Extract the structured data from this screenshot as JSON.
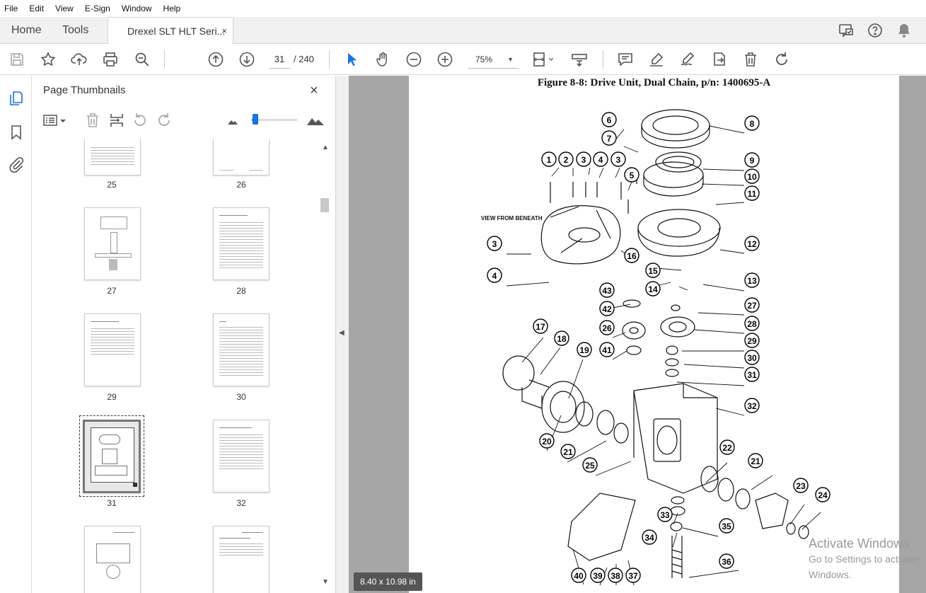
{
  "menu": [
    "File",
    "Edit",
    "View",
    "E-Sign",
    "Window",
    "Help"
  ],
  "tabs": {
    "home": "Home",
    "tools": "Tools",
    "document": "Drexel SLT HLT Seri...",
    "close": "×"
  },
  "nav": {
    "current_page": "31",
    "total_pages": "/ 240",
    "zoom": "75%"
  },
  "icons": [
    "save-icon",
    "star-icon",
    "upload-icon",
    "print-icon",
    "zoom-search-icon",
    "page-up-icon",
    "page-down-icon",
    "select-arrow-icon",
    "hand-icon",
    "zoom-out-icon",
    "zoom-in-icon",
    "fit-page-icon",
    "scroll-mode-icon",
    "comment-icon",
    "highlight-icon",
    "sign-icon",
    "share-icon",
    "delete-icon",
    "rotate-icon",
    "comments-pane-icon",
    "help-icon",
    "bell-icon",
    "thumbnails-icon",
    "bookmarks-icon",
    "attachments-icon"
  ],
  "thumbnails_panel": {
    "title": "Page Thumbnails",
    "close": "×",
    "pages": [
      {
        "label": "25",
        "selected": false
      },
      {
        "label": "26",
        "selected": false
      },
      {
        "label": "27",
        "selected": false
      },
      {
        "label": "28",
        "selected": false
      },
      {
        "label": "29",
        "selected": false
      },
      {
        "label": "30",
        "selected": false
      },
      {
        "label": "31",
        "selected": true
      },
      {
        "label": "32",
        "selected": false
      },
      {
        "label": "",
        "selected": false
      },
      {
        "label": "",
        "selected": false
      }
    ]
  },
  "document": {
    "figure_title": "Figure 8-8:  Drive Unit, Dual Chain, p/n: 1400695-A",
    "view_label": "VIEW FROM BENEATH",
    "page_size": "8.40 x 10.98 in",
    "callouts": [
      "1",
      "2",
      "3",
      "4",
      "3",
      "5",
      "6",
      "7",
      "8",
      "9",
      "10",
      "11",
      "3",
      "16",
      "12",
      "4",
      "15",
      "14",
      "13",
      "43",
      "42",
      "27",
      "26",
      "28",
      "41",
      "29",
      "30",
      "31",
      "17",
      "18",
      "19",
      "32",
      "20",
      "21",
      "25",
      "22",
      "21",
      "23",
      "24",
      "33",
      "35",
      "34",
      "36",
      "40",
      "39",
      "38",
      "37"
    ]
  },
  "watermark": {
    "line1": "Activate Windows",
    "line2": "Go to Settings to activate Windows."
  },
  "colors": {
    "accent": "#1473e6",
    "viewer_bg": "#a6a6a6",
    "tab_bg": "#f1f1f1"
  }
}
